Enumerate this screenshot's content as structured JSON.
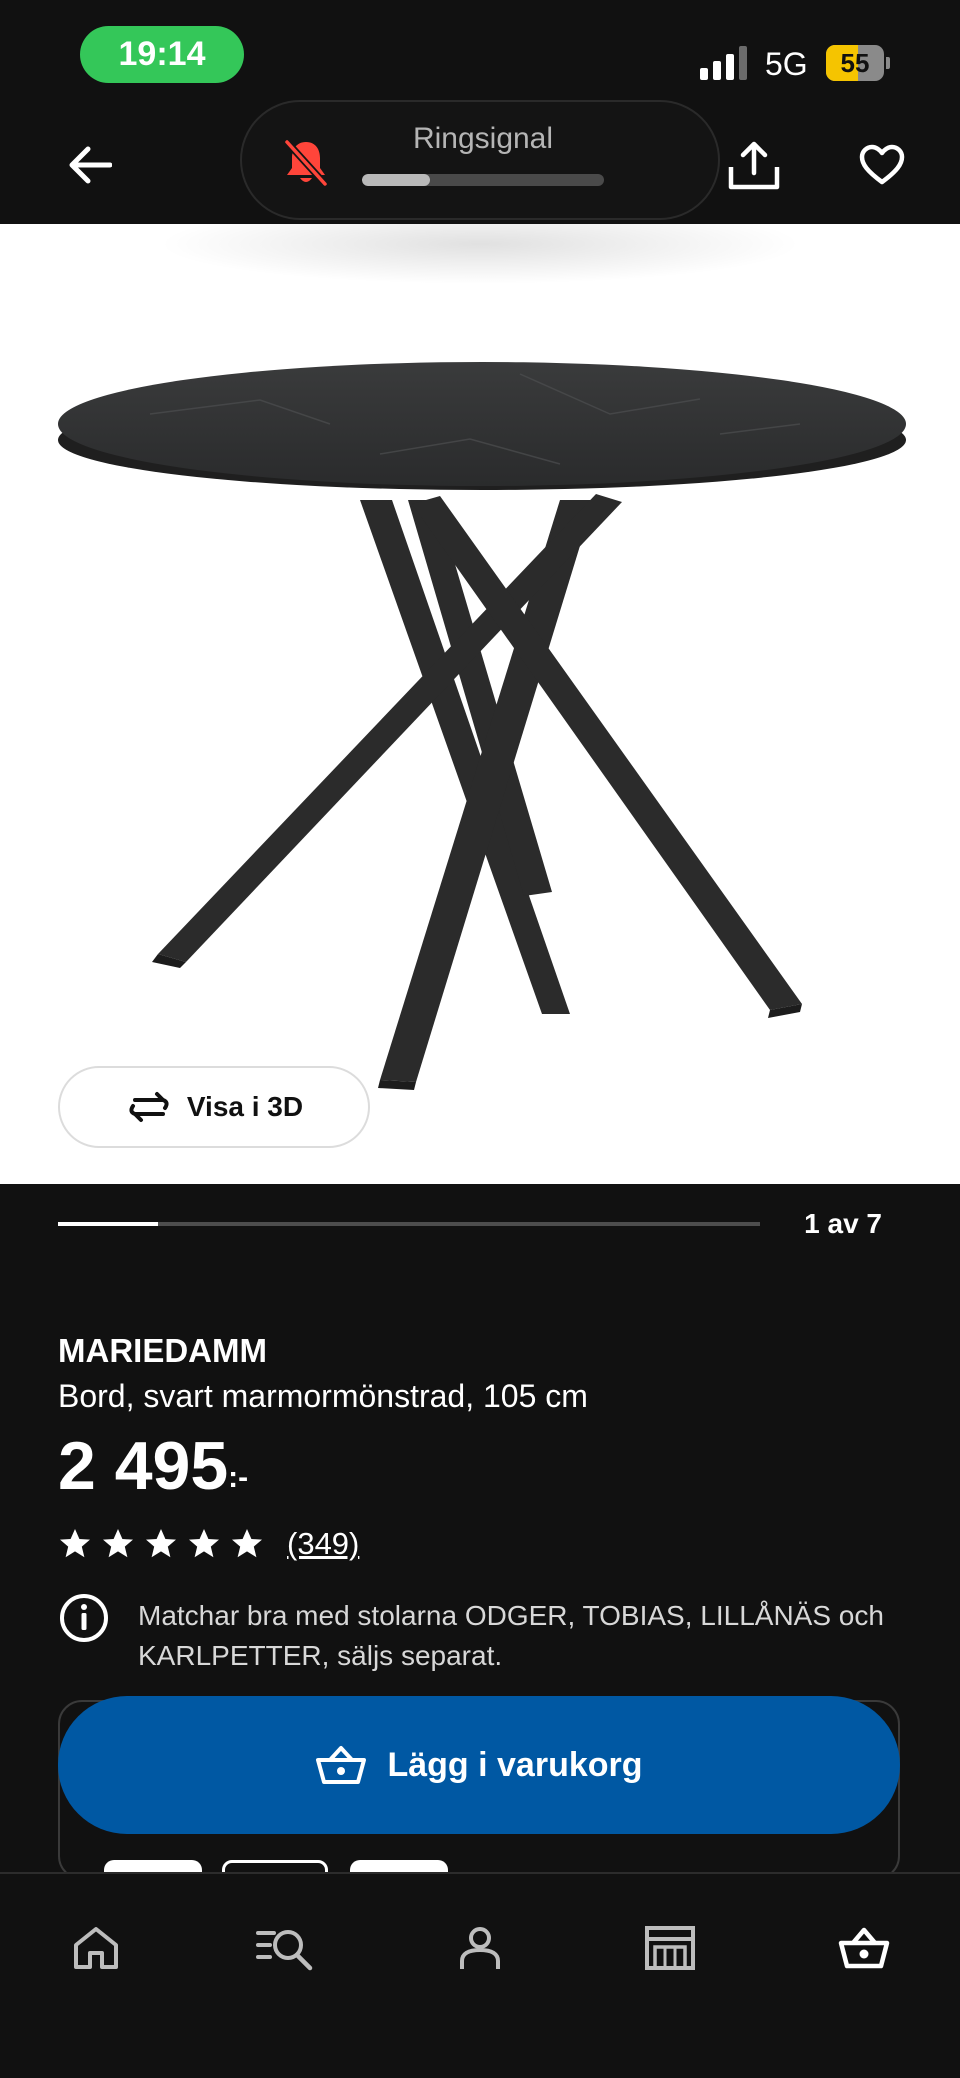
{
  "status_bar": {
    "time": "19:14",
    "network": "5G",
    "battery_level": "55",
    "battery_percent": 55,
    "signal_icon": "cellular-signal-icon"
  },
  "header": {
    "back_icon": "arrow-left-icon",
    "share_icon": "share-icon",
    "favorite_icon": "heart-icon",
    "ringer": {
      "label": "Ringsignal",
      "icon": "bell-slash-icon",
      "volume_fraction": 0.28,
      "icon_color": "#ff453a"
    }
  },
  "gallery": {
    "view_3d_label": "Visa i 3D",
    "view_3d_icon": "rotate-3d-icon",
    "pager_text": "1 av 7",
    "current_index": 1,
    "total": 7
  },
  "product": {
    "name": "MARIEDAMM",
    "description": "Bord, svart marmormönstrad, 105 cm",
    "price": "2 495",
    "price_suffix": ":-",
    "rating_stars": 5,
    "review_count": "(349)",
    "info_text": "Matchar bra med stolarna ODGER, TOBIAS, LILLÅNÄS och KARLPETTER, säljs separat.",
    "info_icon": "info-icon"
  },
  "cart": {
    "add_label": "Lägg i varukorg",
    "icon": "basket-icon",
    "button_color": "#0058a3"
  },
  "bottom_nav": {
    "items": [
      {
        "icon": "home-icon"
      },
      {
        "icon": "search-list-icon"
      },
      {
        "icon": "profile-icon"
      },
      {
        "icon": "store-icon"
      },
      {
        "icon": "basket-icon"
      }
    ]
  }
}
